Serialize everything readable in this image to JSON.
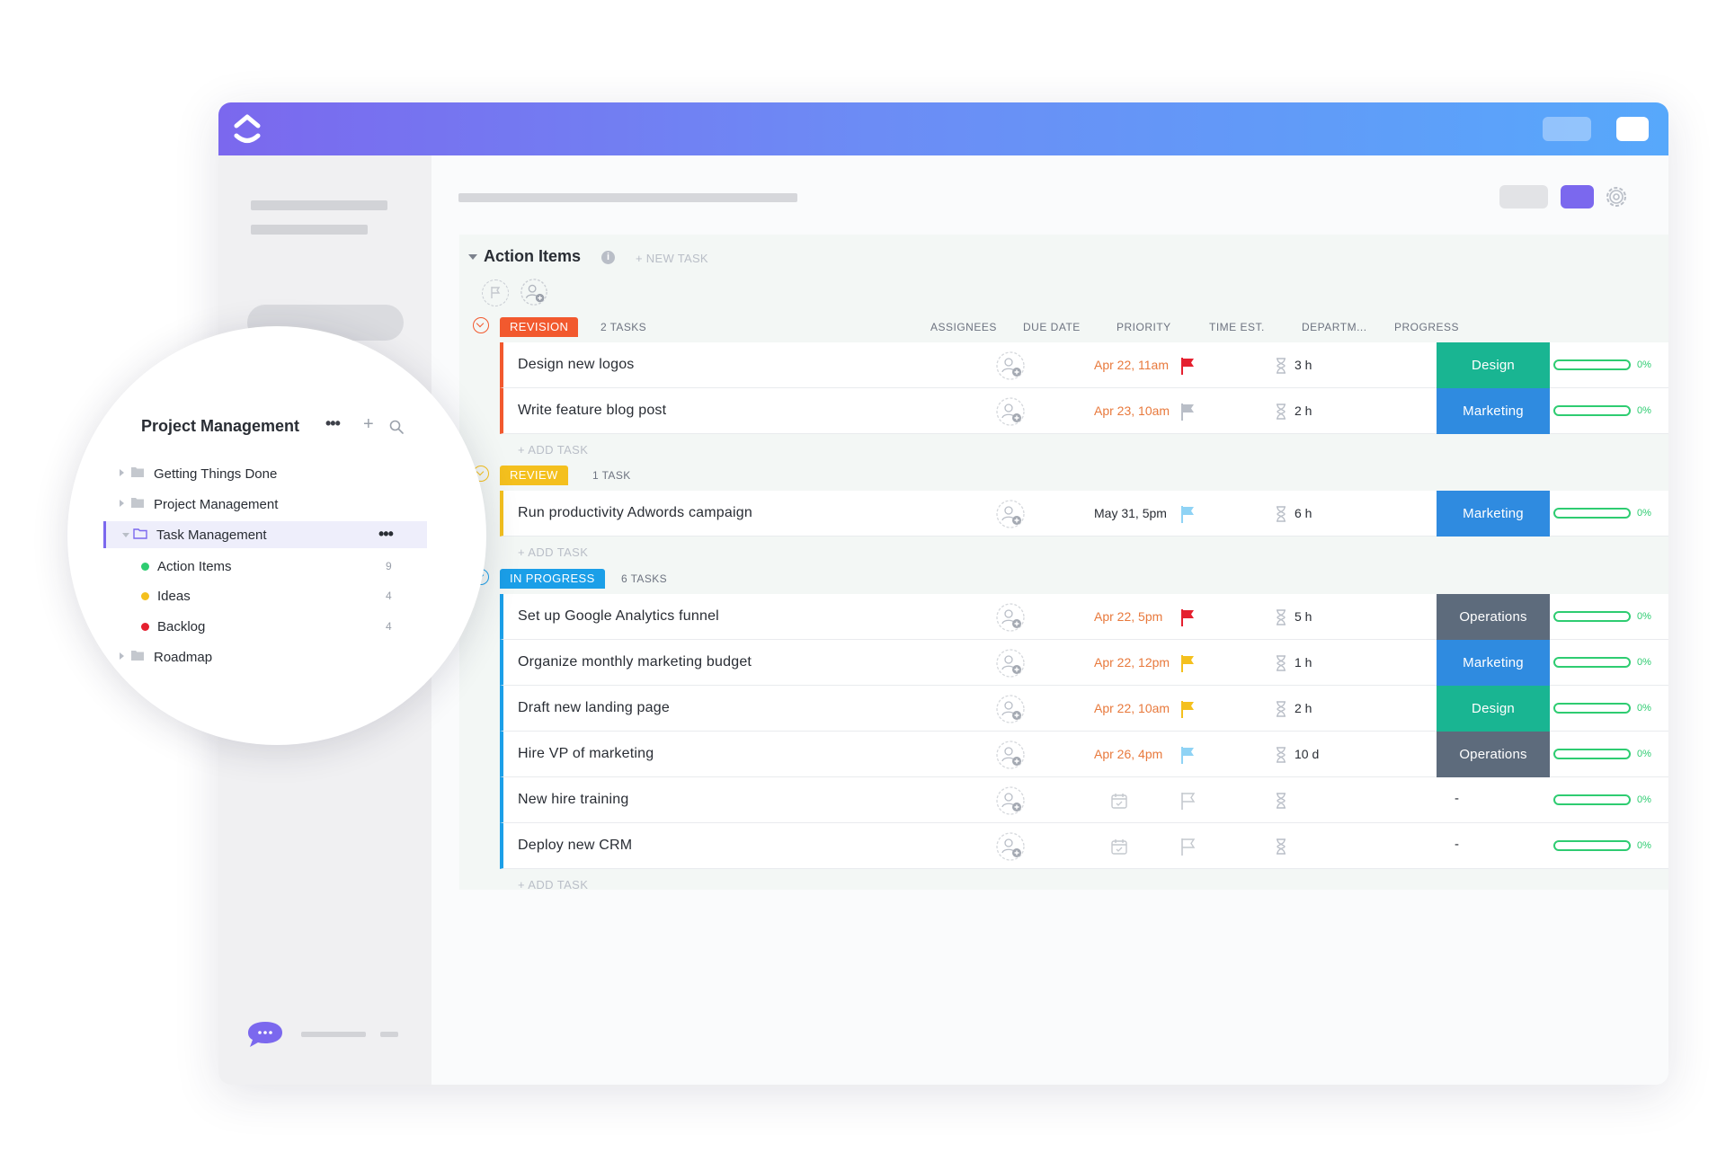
{
  "app": {
    "logo_icon": "clickup-logo-icon",
    "colors": {
      "brand_purple": "#7b68ee",
      "revision": "#f2592e",
      "review": "#f4c01e",
      "in_progress": "#1b9fe8",
      "design": "#19b592",
      "marketing": "#2f8be0",
      "operations": "#5d6b7c",
      "progress": "#2ecc71",
      "overdue": "#e8793c"
    }
  },
  "list": {
    "title": "Action Items",
    "info_icon": "i",
    "new_task_label": "+ NEW TASK",
    "columns": {
      "assignees": "ASSIGNEES",
      "due_date": "DUE DATE",
      "priority": "PRIORITY",
      "time_est": "TIME EST.",
      "department": "DEPARTM...",
      "progress": "PROGRESS"
    },
    "add_task_label": "+ ADD TASK",
    "groups": [
      {
        "status": "REVISION",
        "count": "2 TASKS",
        "color": "#f2592e",
        "tasks": [
          {
            "name": "Design new logos",
            "due": "Apr 22, 11am",
            "due_overdue": true,
            "priority": "urgent",
            "priority_color": "#e5202f",
            "est": "3 h",
            "department": "Design",
            "dept_color": "#19b592",
            "progress": "0%"
          },
          {
            "name": "Write feature blog post",
            "due": "Apr 23, 10am",
            "due_overdue": true,
            "priority": "low",
            "priority_color": "#b9bec7",
            "est": "2 h",
            "department": "Marketing",
            "dept_color": "#2f8be0",
            "progress": "0%"
          }
        ]
      },
      {
        "status": "REVIEW",
        "count": "1 TASK",
        "color": "#f4c01e",
        "tasks": [
          {
            "name": "Run productivity Adwords campaign",
            "due": "May 31, 5pm",
            "due_overdue": false,
            "priority": "normal",
            "priority_color": "#8fd3f5",
            "est": "6 h",
            "department": "Marketing",
            "dept_color": "#2f8be0",
            "progress": "0%"
          }
        ]
      },
      {
        "status": "IN PROGRESS",
        "count": "6 TASKS",
        "color": "#1b9fe8",
        "tasks": [
          {
            "name": "Set up Google Analytics funnel",
            "due": "Apr 22, 5pm",
            "due_overdue": true,
            "priority": "urgent",
            "priority_color": "#e5202f",
            "est": "5 h",
            "department": "Operations",
            "dept_color": "#5d6b7c",
            "progress": "0%"
          },
          {
            "name": "Organize monthly marketing budget",
            "due": "Apr 22, 12pm",
            "due_overdue": true,
            "priority": "high",
            "priority_color": "#f4c01e",
            "est": "1 h",
            "department": "Marketing",
            "dept_color": "#2f8be0",
            "progress": "0%"
          },
          {
            "name": "Draft new landing page",
            "due": "Apr 22, 10am",
            "due_overdue": true,
            "priority": "high",
            "priority_color": "#f4c01e",
            "est": "2 h",
            "department": "Design",
            "dept_color": "#19b592",
            "progress": "0%"
          },
          {
            "name": "Hire VP of marketing",
            "due": "Apr 26, 4pm",
            "due_overdue": true,
            "priority": "normal",
            "priority_color": "#8fd3f5",
            "est": "10 d",
            "department": "Operations",
            "dept_color": "#5d6b7c",
            "progress": "0%"
          },
          {
            "name": "New hire training",
            "due": "",
            "due_overdue": false,
            "priority": "none",
            "priority_color": "#c4c8ce",
            "est": "",
            "department": "-",
            "dept_color": "",
            "progress": "0%"
          },
          {
            "name": "Deploy new CRM",
            "due": "",
            "due_overdue": false,
            "priority": "none",
            "priority_color": "#c4c8ce",
            "est": "",
            "department": "-",
            "dept_color": "",
            "progress": "0%"
          }
        ]
      }
    ]
  },
  "sidebar_zoom": {
    "title": "Project Management",
    "more_icon": "•••",
    "plus_icon": "+",
    "items": [
      {
        "label": "Getting Things Done",
        "type": "folder",
        "count": ""
      },
      {
        "label": "Project Management",
        "type": "folder",
        "count": ""
      },
      {
        "label": "Task Management",
        "type": "folder-open",
        "count": "",
        "selected": true,
        "more": "•••"
      },
      {
        "label": "Action Items",
        "type": "list",
        "dot_color": "#2ecc71",
        "count": "9"
      },
      {
        "label": "Ideas",
        "type": "list",
        "dot_color": "#f4c01e",
        "count": "4"
      },
      {
        "label": "Backlog",
        "type": "list",
        "dot_color": "#e5202f",
        "count": "4"
      },
      {
        "label": "Roadmap",
        "type": "folder",
        "count": ""
      }
    ]
  }
}
